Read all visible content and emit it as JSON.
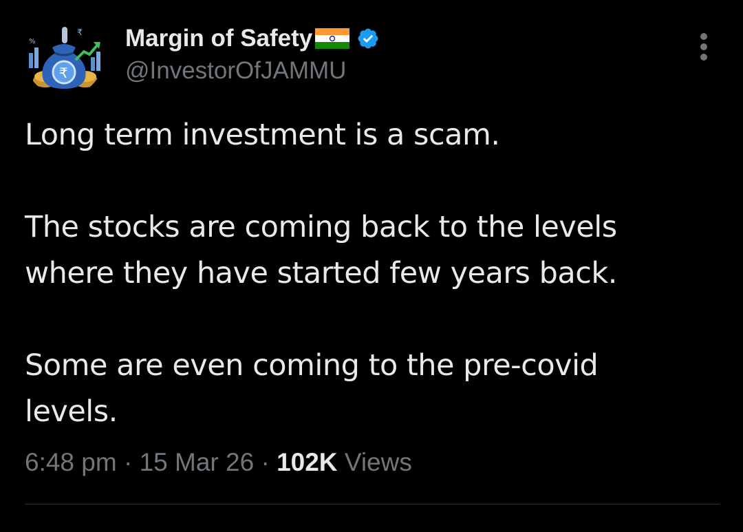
{
  "author": {
    "display_name": "Margin of Safety",
    "flag_icon": "india-flag-icon",
    "verified_icon": "verified-badge-icon",
    "handle": "@InvestorOfJAMMU"
  },
  "tweet": {
    "paragraphs": [
      "Long term investment is a scam.",
      "The stocks are coming back to the levels\nwhere they have started few years back.",
      "Some are even coming to the pre-covid\nlevels."
    ]
  },
  "meta": {
    "time": "6:48 pm",
    "separator": "·",
    "date": "15 Mar 26",
    "views_count": "102K",
    "views_label": "Views"
  },
  "colors": {
    "background": "#000000",
    "primary_text": "#e7e9ea",
    "secondary_text": "#71767b",
    "verified": "#1d9bf0",
    "divider": "#2f3336"
  }
}
